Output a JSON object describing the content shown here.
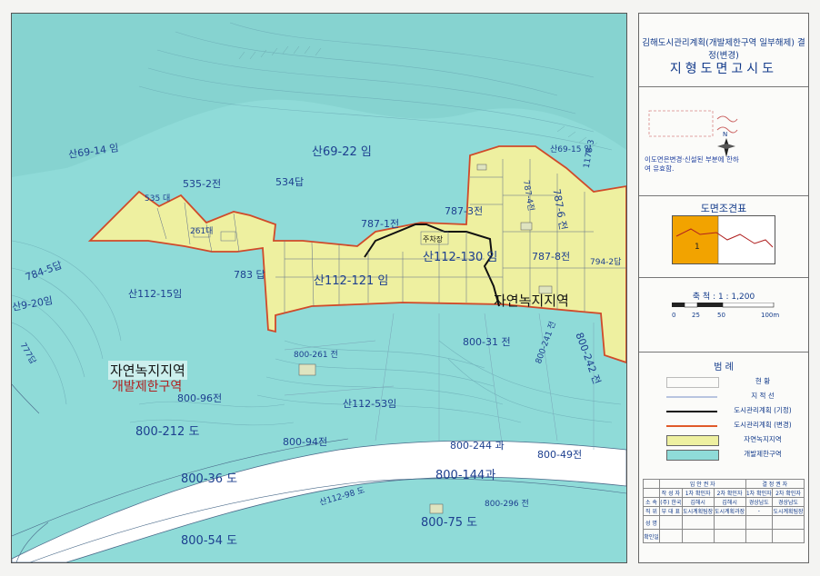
{
  "panel": {
    "title_line1": "김해도시관리계획(개발제한구역 일부해제) 결정(변경)",
    "title_line2": "지형도면고시도",
    "note": "이도면은변경·신설된 부분에 한하여 유효함.",
    "index_title": "도면조견표",
    "index_sheet_number": "1",
    "scale_text": "축 척 : 1 : 1,200",
    "scale_ticks": [
      "0",
      "25",
      "50",
      "100m"
    ],
    "legend_title": "범 례",
    "legend": [
      {
        "label": "현 황",
        "style": "blank"
      },
      {
        "label": "지 적 선",
        "style": "line",
        "color": "#b8c4e0"
      },
      {
        "label": "도시관리계획 (기정)",
        "style": "line",
        "color": "#111111"
      },
      {
        "label": "도시관리계획 (변경)",
        "style": "line",
        "color": "#e05a2a"
      },
      {
        "label": "자연녹지지역",
        "style": "fill",
        "color": "#eef0a0"
      },
      {
        "label": "개발제한구역",
        "style": "fill",
        "color": "#8fdbd8"
      }
    ],
    "approval_header": [
      "입 안 권 자",
      "결 정 권 자"
    ],
    "approval_cols": [
      "작 성 자",
      "1차 확인자",
      "2차 확인자",
      "1차 확인자",
      "2차 확인자"
    ],
    "approval_rows": [
      [
        "소 속",
        "(주) 한국",
        "김해시",
        "김해시",
        "경상남도",
        "경상남도"
      ],
      [
        "직 위",
        "부 대 표",
        "도시계획팀장",
        "도시계획과장",
        "-",
        "도시계획팀장"
      ],
      [
        "성 명",
        "",
        "",
        "",
        "",
        ""
      ],
      [
        "확인일",
        "",
        "",
        "",
        "",
        ""
      ]
    ]
  },
  "map": {
    "labels": [
      {
        "text": "산69-14 임",
        "size": "m"
      },
      {
        "text": "535-2전",
        "size": "m"
      },
      {
        "text": "534답",
        "size": "m"
      },
      {
        "text": "산69-22 임",
        "size": "l"
      },
      {
        "text": "535 대",
        "size": "s"
      },
      {
        "text": "261대",
        "size": "s"
      },
      {
        "text": "787-1전",
        "size": "m"
      },
      {
        "text": "787-3전",
        "size": "m"
      },
      {
        "text": "주차장",
        "size": "s"
      },
      {
        "text": "산112-130 임",
        "size": "l"
      },
      {
        "text": "787-8전",
        "size": "m"
      },
      {
        "text": "787-6 전",
        "size": "m"
      },
      {
        "text": "787-4전",
        "size": "s"
      },
      {
        "text": "794-2답",
        "size": "s"
      },
      {
        "text": "784-5답",
        "size": "m"
      },
      {
        "text": "783 답",
        "size": "m"
      },
      {
        "text": "산112-121 임",
        "size": "l"
      },
      {
        "text": "산112-15임",
        "size": "m"
      },
      {
        "text": "산9-20임",
        "size": "m"
      },
      {
        "text": "777답",
        "size": "s"
      },
      {
        "text": "800-261 전",
        "size": "s"
      },
      {
        "text": "800-31 전",
        "size": "m"
      },
      {
        "text": "800-241 전",
        "size": "s"
      },
      {
        "text": "800-242 전",
        "size": "m"
      },
      {
        "text": "800-96전",
        "size": "m"
      },
      {
        "text": "산112-53임",
        "size": "m"
      },
      {
        "text": "800-212 도",
        "size": "l"
      },
      {
        "text": "800-94전",
        "size": "m"
      },
      {
        "text": "800-244 과",
        "size": "m"
      },
      {
        "text": "800-49전",
        "size": "m"
      },
      {
        "text": "800-144과",
        "size": "l"
      },
      {
        "text": "800-36 도",
        "size": "l"
      },
      {
        "text": "800-75 도",
        "size": "l"
      },
      {
        "text": "800-54 도",
        "size": "l"
      },
      {
        "text": "산112-98 도",
        "size": "s"
      },
      {
        "text": "800-296 전",
        "size": "s"
      },
      {
        "text": "1178-3",
        "size": "s"
      },
      {
        "text": "산69-15 임",
        "size": "s"
      }
    ],
    "zone_labels": {
      "left_top": "자연녹지지역",
      "left_bottom": "개발제한구역",
      "right": "자연녹지지역"
    }
  }
}
